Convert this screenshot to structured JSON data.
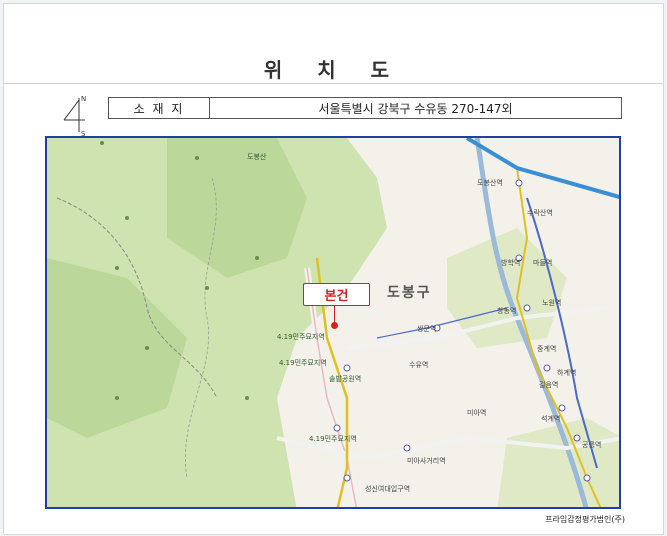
{
  "page": {
    "title": "위 치 도",
    "footer": "프라임감정평가법인(주)"
  },
  "compass": {
    "north": "N",
    "south": "S"
  },
  "address": {
    "label": "소 재 지",
    "value": "서울특별시 강북구 수유동 270-147외"
  },
  "map": {
    "subject_label": "본건",
    "district_label": "도봉구",
    "labels": [
      "도봉산역",
      "방학역",
      "쌍문역",
      "수유역",
      "미아역",
      "노원역",
      "창동역",
      "중계역",
      "하계역",
      "공릉역",
      "석계역",
      "미아사거리역",
      "길음역",
      "성신여대입구역",
      "보문역",
      "국립재활원",
      "4.19민주묘지역",
      "솔밭공원역",
      "수락산역",
      "마들역",
      "상계역",
      "태릉입구역",
      "도봉산"
    ],
    "colors": {
      "forest": "#c9dfa9",
      "subway_blue": "#3a8fd4",
      "subway_yellow": "#e0c020",
      "frame": "#1e3ea8",
      "marker": "#e31c1c"
    }
  }
}
